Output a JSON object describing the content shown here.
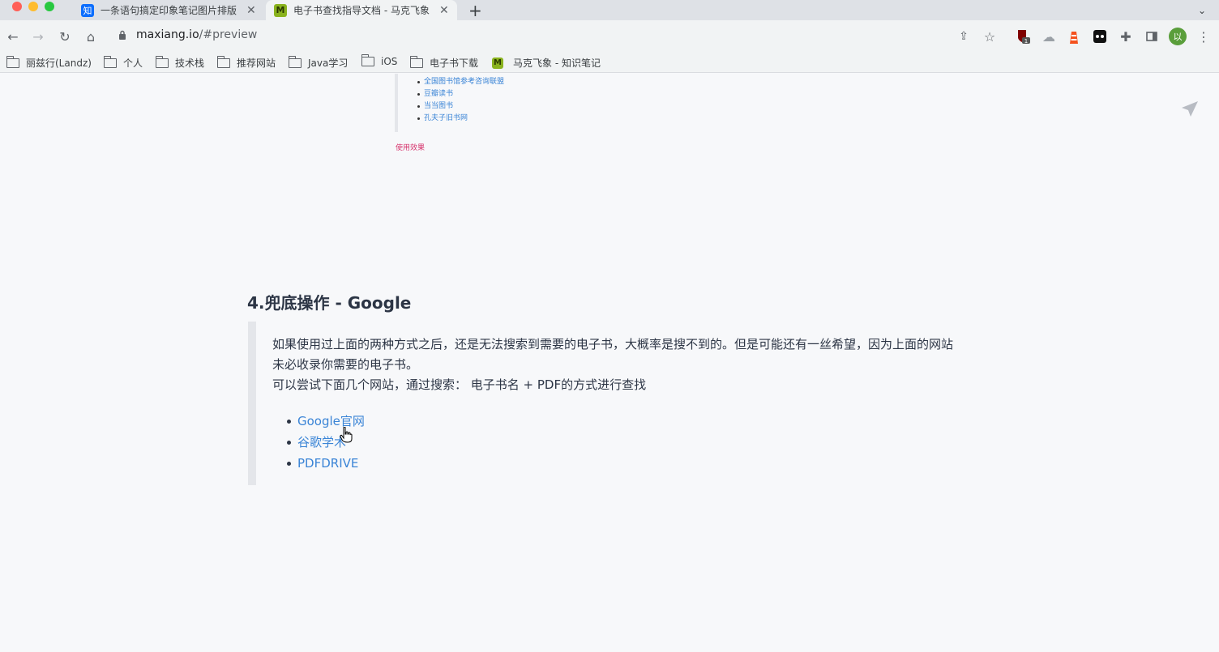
{
  "browser": {
    "tabs": [
      {
        "title": "一条语句搞定印象笔记图片排版",
        "favicon": "知",
        "favicon_color": "#0d6efd",
        "active": false
      },
      {
        "title": "电子书查找指导文档 - 马克飞象",
        "favicon": "M",
        "favicon_color": "#8ab31e",
        "active": true
      }
    ],
    "new_tab": "+",
    "address": {
      "host": "maxiang.io",
      "path": "/#preview"
    },
    "profile_initial": "以",
    "extension_badge": "1",
    "bookmarks": [
      {
        "label": "丽兹行(Landz)",
        "icon": "folder-icon"
      },
      {
        "label": "个人",
        "icon": "folder-icon"
      },
      {
        "label": "技术栈",
        "icon": "folder-icon"
      },
      {
        "label": "推荐网站",
        "icon": "folder-icon"
      },
      {
        "label": "Java学习",
        "icon": "folder-icon"
      },
      {
        "label": "iOS",
        "icon": "folder-icon"
      },
      {
        "label": "电子书下载",
        "icon": "folder-icon"
      },
      {
        "label": "马克飞象 - 知识笔记",
        "icon": "maxiang-favicon"
      }
    ]
  },
  "doc": {
    "prev_list": [
      "全国图书馆参考咨询联盟",
      "豆瓣读书",
      "当当图书",
      "孔夫子旧书网"
    ],
    "prev_caption": "使用效果",
    "heading": "4.兜底操作 - Google",
    "para_line1": "如果使用过上面的两种方式之后，还是无法搜索到需要的电子书，大概率是搜不到的。但是可能还有一丝希望，因为上面的网站未必收录你需要的电子书。",
    "para_line2": "可以尝试下面几个网站，通过搜索： 电子书名 + PDF的方式进行查找",
    "links": [
      "Google官网",
      "谷歌学术",
      "PDFDRIVE"
    ],
    "colors": {
      "link": "#3a84d6",
      "text": "#2c3545",
      "caption": "#d6336c"
    }
  }
}
